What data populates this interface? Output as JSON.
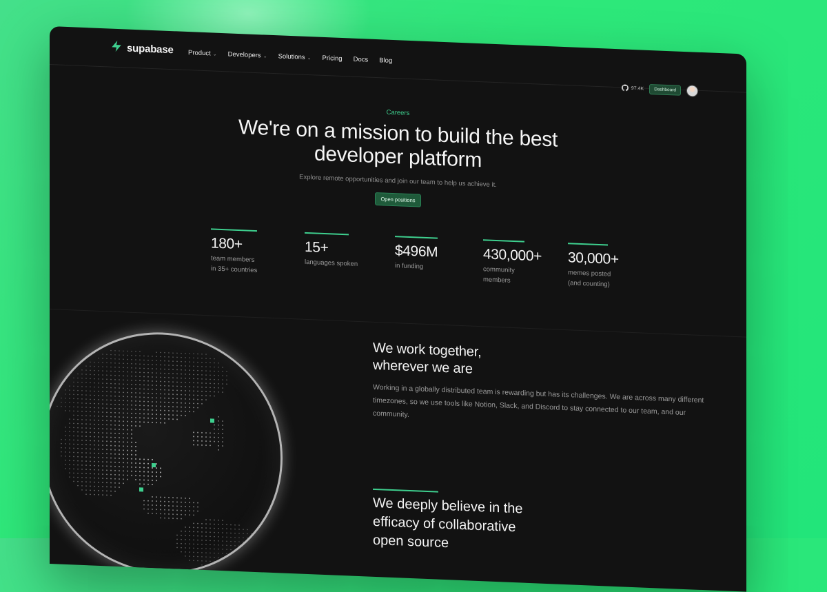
{
  "brand": {
    "name": "supabase",
    "accent": "#3ecf8e",
    "background": "#121212",
    "page_bg": "#2ee87a"
  },
  "nav": {
    "items": [
      {
        "label": "Product",
        "dropdown": true
      },
      {
        "label": "Developers",
        "dropdown": true
      },
      {
        "label": "Solutions",
        "dropdown": true
      },
      {
        "label": "Pricing",
        "dropdown": false
      },
      {
        "label": "Docs",
        "dropdown": false
      },
      {
        "label": "Blog",
        "dropdown": false
      }
    ],
    "github_stars": "97.4K",
    "dashboard_label": "Dashboard"
  },
  "hero": {
    "eyebrow": "Careers",
    "title_line1": "We're on a mission to build the best",
    "title_line2": "developer platform",
    "subtitle": "Explore remote opportunities and join our team to help us achieve it.",
    "cta": "Open positions"
  },
  "stats": [
    {
      "value": "180+",
      "line1": "team members",
      "line2": "in 35+ countries"
    },
    {
      "value": "15+",
      "line1": "languages spoken",
      "line2": ""
    },
    {
      "value": "$496M",
      "line1": "in funding",
      "line2": ""
    },
    {
      "value": "430,000+",
      "line1": "community",
      "line2": "members"
    },
    {
      "value": "30,000+",
      "line1": "memes posted",
      "line2": "(and counting)"
    }
  ],
  "together": {
    "title_line1": "We work together,",
    "title_line2": "wherever we are",
    "body": "Working in a globally distributed team is rewarding but has its challenges. We are across many different timezones, so we use tools like Notion, Slack, and Discord to stay connected to our team, and our community."
  },
  "open_source": {
    "title_line1": "We deeply believe in the",
    "title_line2": "efficacy of collaborative",
    "title_line3": "open source"
  }
}
